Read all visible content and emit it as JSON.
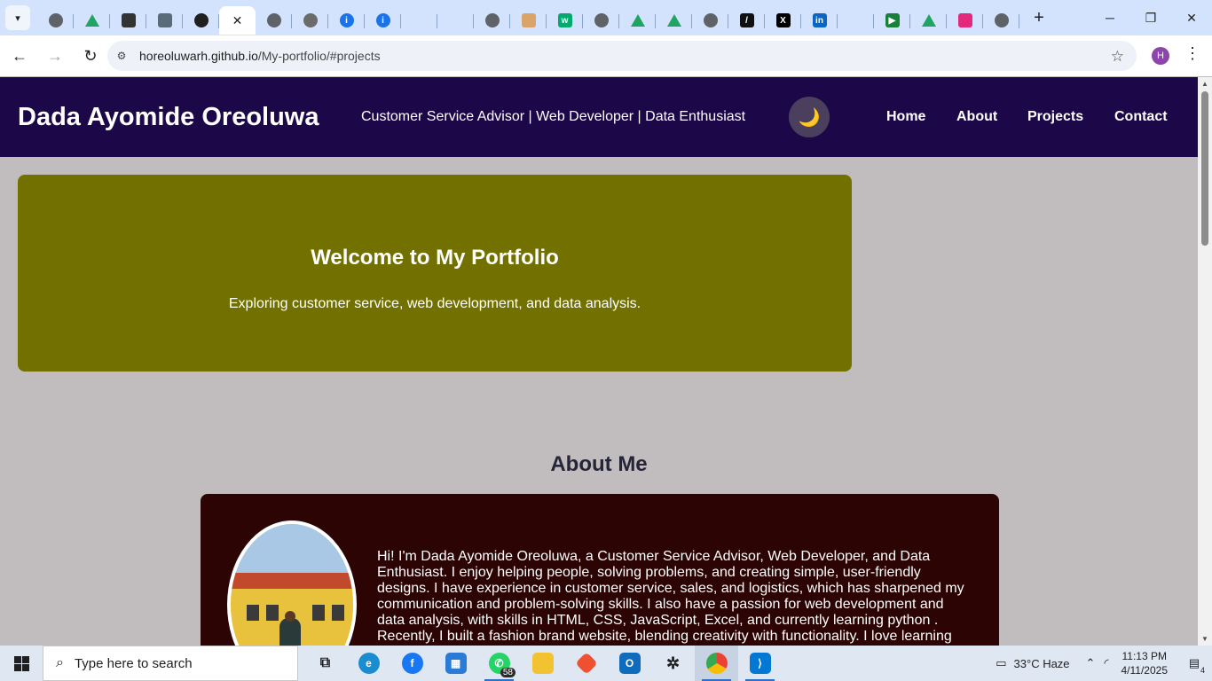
{
  "browser": {
    "tabs": [
      {
        "icon": "globe-icon",
        "active": false
      },
      {
        "icon": "google-drive-icon",
        "active": false
      },
      {
        "icon": "robot-icon",
        "active": false
      },
      {
        "icon": "cisco-icon",
        "active": false
      },
      {
        "icon": "github-icon",
        "active": false
      },
      {
        "icon": "close-icon",
        "active": true
      },
      {
        "icon": "globe-icon",
        "active": false
      },
      {
        "icon": "loading-icon",
        "active": false
      },
      {
        "icon": "info-icon",
        "active": false
      },
      {
        "icon": "info-icon",
        "active": false
      },
      {
        "icon": "blank-icon",
        "active": false
      },
      {
        "icon": "blank-icon",
        "active": false
      },
      {
        "icon": "globe-icon",
        "active": false
      },
      {
        "icon": "image-icon",
        "active": false
      },
      {
        "icon": "w3schools-icon",
        "active": false
      },
      {
        "icon": "globe-icon",
        "active": false
      },
      {
        "icon": "google-drive-icon",
        "active": false
      },
      {
        "icon": "google-drive-icon",
        "active": false
      },
      {
        "icon": "globe-icon",
        "active": false
      },
      {
        "icon": "code-icon",
        "active": false
      },
      {
        "icon": "x-icon",
        "active": false
      },
      {
        "icon": "linkedin-icon",
        "active": false
      },
      {
        "icon": "blank-icon",
        "active": false
      },
      {
        "icon": "play-icon",
        "active": false
      },
      {
        "icon": "google-drive-icon",
        "active": false
      },
      {
        "icon": "cube-icon",
        "active": false
      },
      {
        "icon": "globe-icon",
        "active": false
      }
    ],
    "address": {
      "host": "horeoluwarh.github.io",
      "path": "/My-portfolio/#projects"
    },
    "profile_initial": "H"
  },
  "site": {
    "brand": "Dada Ayomide Oreoluwa",
    "tagline": "Customer Service Advisor | Web Developer | Data Enthusiast",
    "theme_toggle_glyph": "🌙",
    "nav": [
      "Home",
      "About",
      "Projects",
      "Contact"
    ],
    "hero": {
      "title": "Welcome to My Portfolio",
      "subtitle": "Exploring customer service, web development, and data analysis."
    },
    "about": {
      "title": "About Me",
      "text": "Hi! I'm Dada Ayomide Oreoluwa, a Customer Service Advisor, Web Developer, and Data Enthusiast. I enjoy helping people, solving problems, and creating simple, user-friendly designs. I have experience in customer service, sales, and logistics, which has sharpened my communication and problem-solving skills. I also have a passion for web development and data analysis, with skills in HTML, CSS, JavaScript, Excel, and currently learning python . Recently, I built a fashion brand website, blending creativity with functionality. I love learning"
    },
    "colors": {
      "header_bg": "#1c0848",
      "hero_bg": "#727100",
      "about_card_bg": "#2c0404",
      "page_bg": "#c1bcbd"
    }
  },
  "taskbar": {
    "search_placeholder": "Type here to search",
    "apps": [
      {
        "icon": "task-view-icon",
        "label": ""
      },
      {
        "icon": "edge-icon",
        "label": ""
      },
      {
        "icon": "facebook-icon",
        "label": ""
      },
      {
        "icon": "microsoft-store-icon",
        "label": ""
      },
      {
        "icon": "whatsapp-icon",
        "label": "58"
      },
      {
        "icon": "file-explorer-icon",
        "label": ""
      },
      {
        "icon": "git-icon",
        "label": ""
      },
      {
        "icon": "outlook-icon",
        "label": ""
      },
      {
        "icon": "chatgpt-icon",
        "label": ""
      },
      {
        "icon": "chrome-icon",
        "label": ""
      },
      {
        "icon": "vscode-icon",
        "label": ""
      }
    ],
    "weather": "33°C  Haze",
    "time": "11:13 PM",
    "date": "4/11/2025",
    "notifications": "4"
  }
}
